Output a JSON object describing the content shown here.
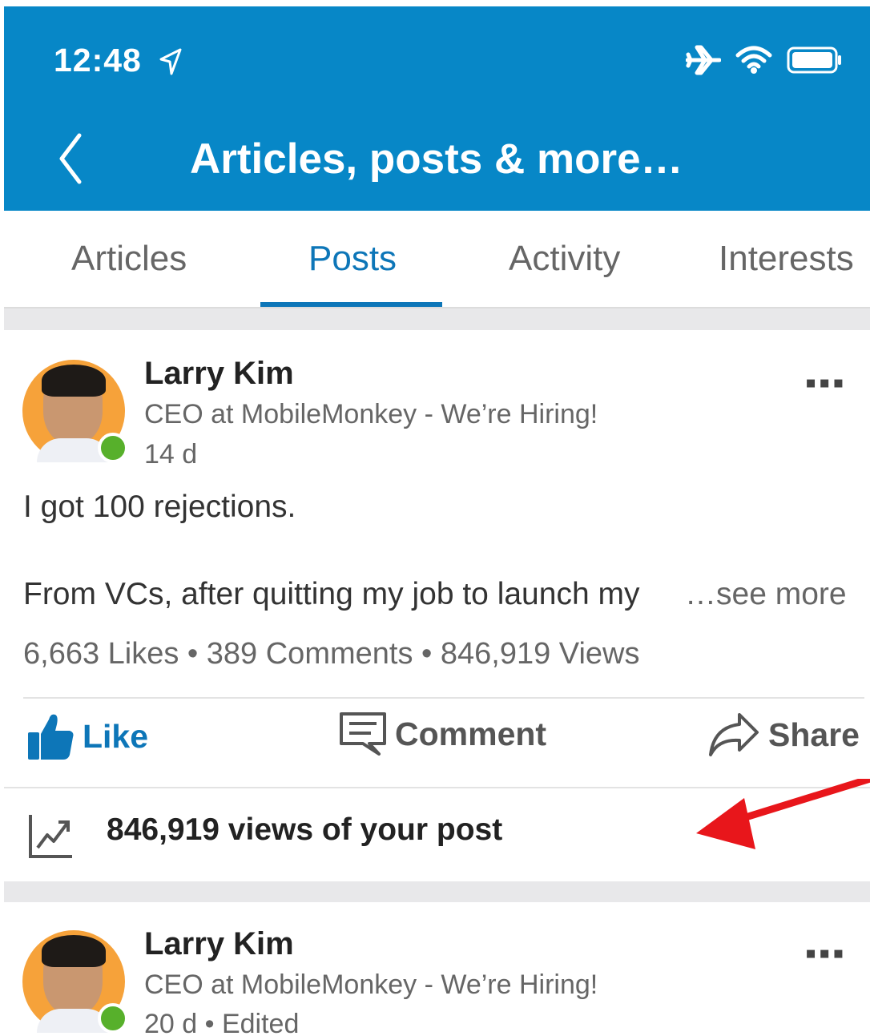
{
  "status_bar": {
    "time": "12:48"
  },
  "header": {
    "title": "Articles, posts & more…"
  },
  "tabs": [
    {
      "label": "Articles",
      "active": false
    },
    {
      "label": "Posts",
      "active": true
    },
    {
      "label": "Activity",
      "active": false
    },
    {
      "label": "Interests",
      "active": false
    }
  ],
  "posts": [
    {
      "author": "Larry Kim",
      "headline": "CEO at MobileMonkey - We’re Hiring!",
      "time": "14 d",
      "text_line1": "I got 100 rejections.",
      "text_line2": "From VCs, after quitting my job to launch my",
      "see_more": "…see more",
      "stats": "6,663 Likes • 389 Comments • 846,919 Views",
      "actions": {
        "like": "Like",
        "comment": "Comment",
        "share": "Share"
      },
      "views_summary": "846,919 views of your post"
    },
    {
      "author": "Larry Kim",
      "headline": "CEO at MobileMonkey - We’re Hiring!",
      "time": "20 d • Edited"
    }
  ],
  "colors": {
    "header_bg": "#0787c7",
    "accent": "#0d76b8",
    "online": "#57b02b",
    "annotation_arrow": "#e8161b"
  }
}
